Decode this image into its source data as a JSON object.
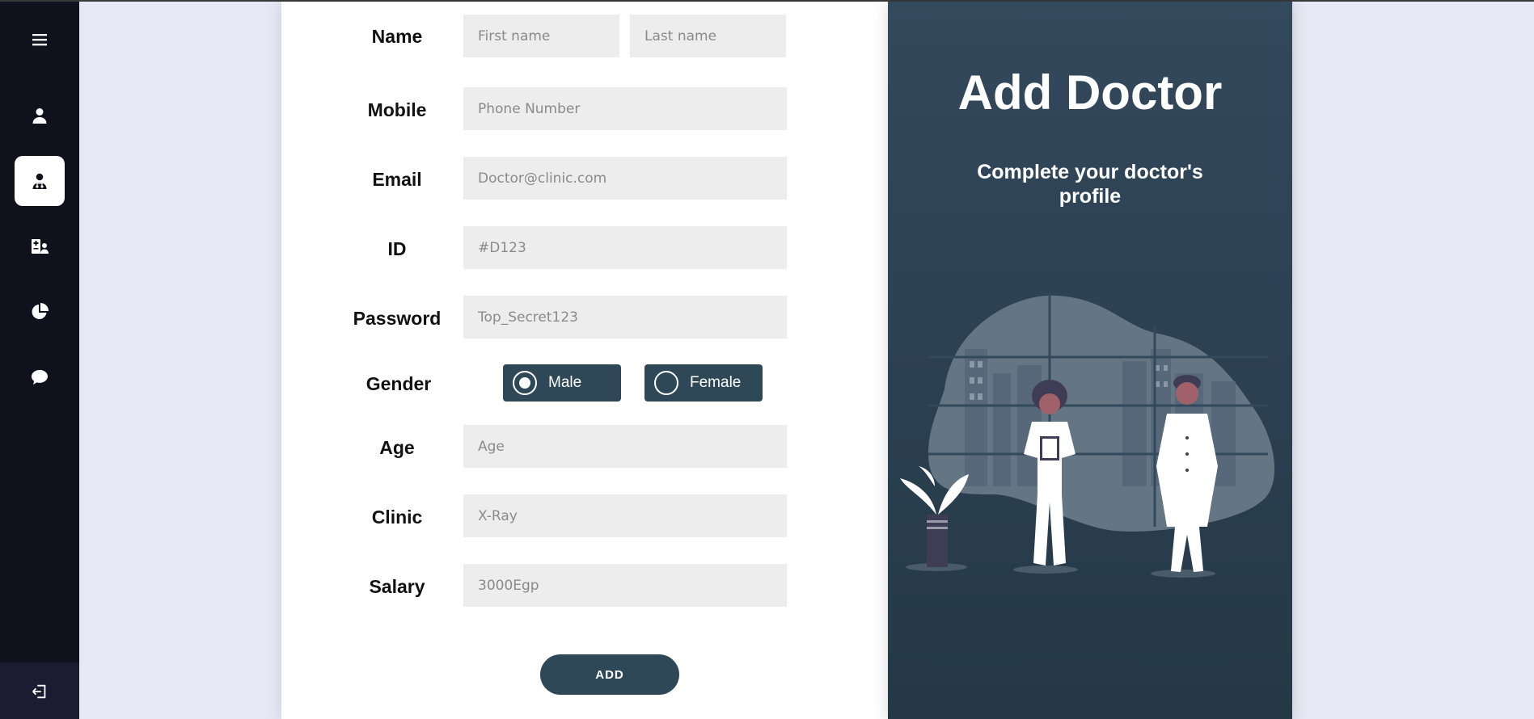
{
  "sidebar": {
    "items": [
      {
        "icon": "menu-icon"
      },
      {
        "icon": "user-icon"
      },
      {
        "icon": "doctor-icon",
        "active": true
      },
      {
        "icon": "patient-card-icon"
      },
      {
        "icon": "pie-chart-icon"
      },
      {
        "icon": "chat-icon"
      }
    ],
    "logout_icon": "logout-icon"
  },
  "form": {
    "name": {
      "label": "Name",
      "first_placeholder": "First name",
      "last_placeholder": "Last name"
    },
    "mobile": {
      "label": "Mobile",
      "placeholder": "Phone Number"
    },
    "email": {
      "label": "Email",
      "placeholder": "Doctor@clinic.com"
    },
    "id": {
      "label": "ID",
      "placeholder": "#D123"
    },
    "password": {
      "label": "Password",
      "placeholder": "Top_Secret123"
    },
    "gender": {
      "label": "Gender",
      "options": [
        {
          "label": "Male",
          "selected": true
        },
        {
          "label": "Female",
          "selected": false
        }
      ]
    },
    "age": {
      "label": "Age",
      "placeholder": "Age"
    },
    "clinic": {
      "label": "Clinic",
      "placeholder": "X-Ray"
    },
    "salary": {
      "label": "Salary",
      "placeholder": "3000Egp"
    },
    "submit_label": "ADD"
  },
  "hero": {
    "title": "Add Doctor",
    "subtitle": "Complete your doctor's profile"
  },
  "colors": {
    "sidebar_bg": "#11101d",
    "accent": "#2f4858",
    "page_bg": "#e6e8f5",
    "field_bg": "#ededed"
  }
}
